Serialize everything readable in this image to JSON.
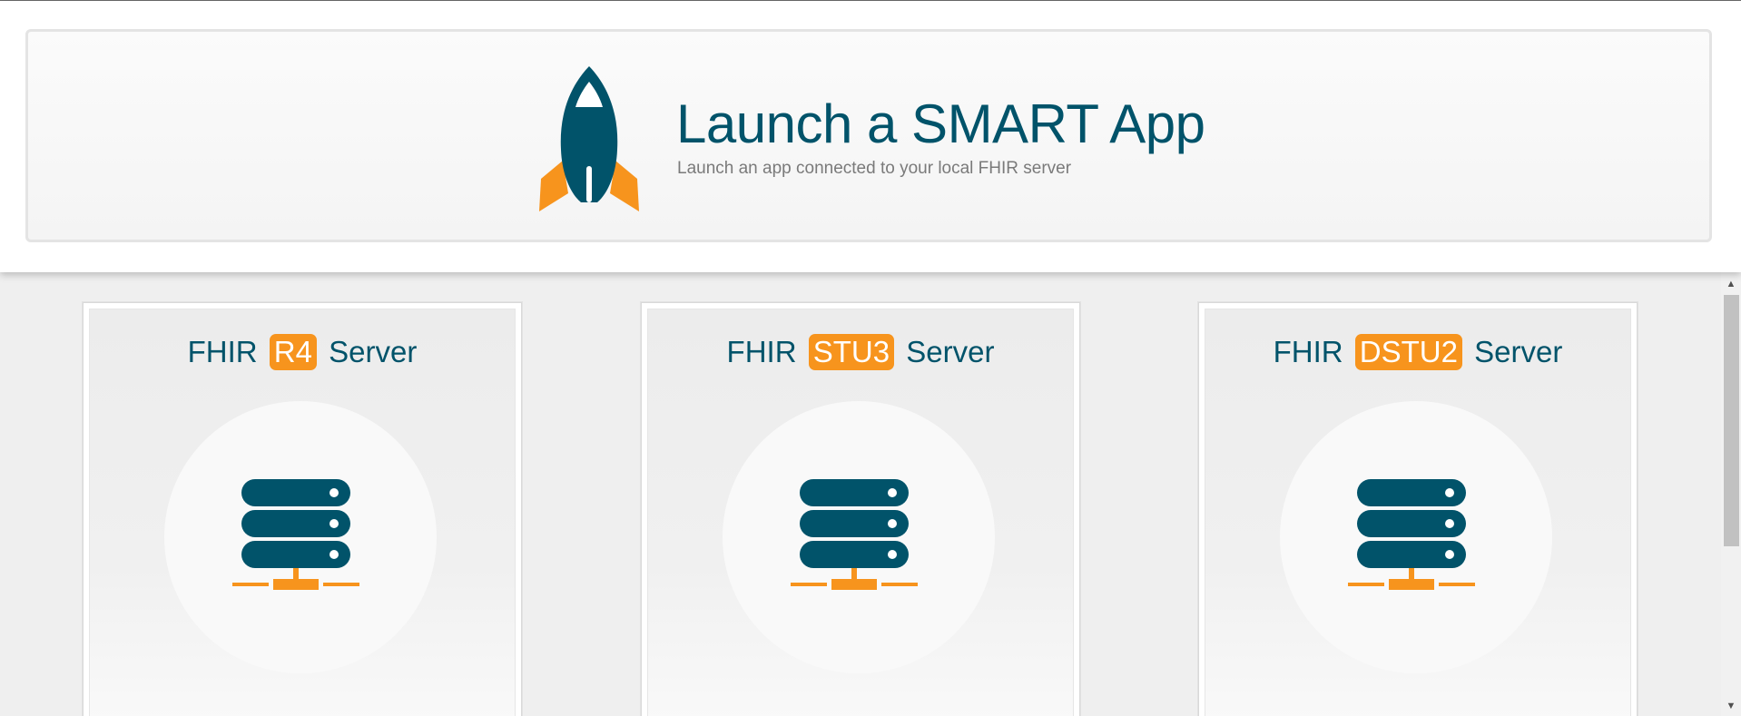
{
  "header": {
    "title": "Launch a SMART App",
    "subtitle": "Launch an app connected to your local FHIR server"
  },
  "servers": [
    {
      "prefix": "FHIR",
      "version": "R4",
      "suffix": "Server"
    },
    {
      "prefix": "FHIR",
      "version": "STU3",
      "suffix": "Server"
    },
    {
      "prefix": "FHIR",
      "version": "DSTU2",
      "suffix": "Server"
    }
  ],
  "colors": {
    "brand": "#01536a",
    "accent": "#f7941d",
    "subtitle": "#7a7a7a"
  },
  "icons": {
    "logo": "rocket-icon",
    "server": "server-icon",
    "scroll_up": "arrow-up-icon",
    "scroll_down": "arrow-down-icon"
  }
}
